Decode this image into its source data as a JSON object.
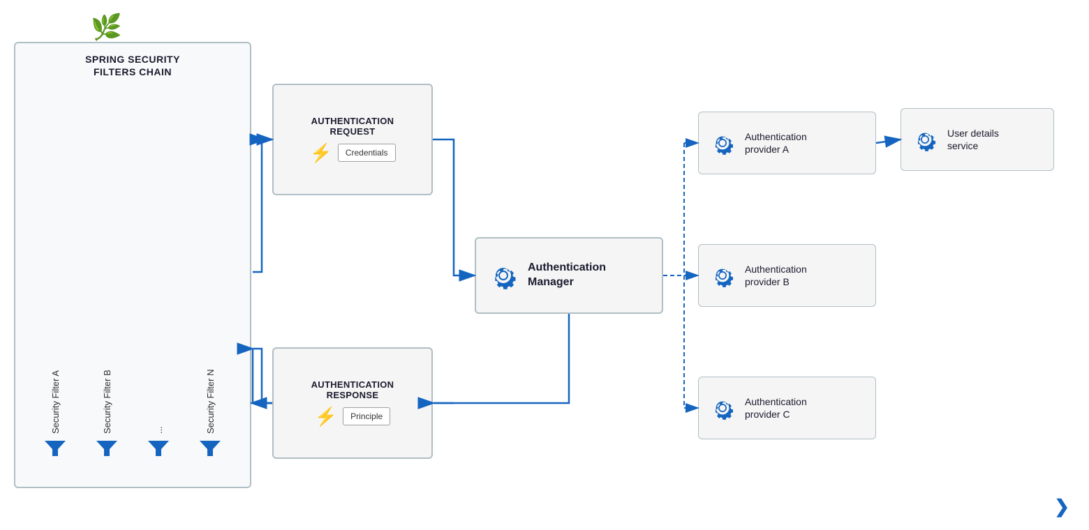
{
  "logo": {
    "icon": "🌿",
    "alt": "Spring Logo"
  },
  "filtersChain": {
    "title": "SPRING SECURITY\nFILTERS CHAIN",
    "filters": [
      {
        "label": "Security Filter A"
      },
      {
        "label": "Security Filter B"
      },
      {
        "label": "..."
      },
      {
        "label": "Security Filter N"
      }
    ]
  },
  "authRequest": {
    "title": "AUTHENTICATION\nREQUEST",
    "credentials_label": "Credentials"
  },
  "authResponse": {
    "title": "AUTHENTICATION\nRESPONSE",
    "principle_label": "Principle"
  },
  "authManager": {
    "label": "Authentication\nManager"
  },
  "providers": [
    {
      "label": "Authentication\nprovider A",
      "id": "provider-a"
    },
    {
      "label": "Authentication\nprovider B",
      "id": "provider-b"
    },
    {
      "label": "Authentication\nprovider C",
      "id": "provider-c"
    }
  ],
  "userDetails": {
    "label": "User details\nservice"
  },
  "codicaLogo": "❯"
}
